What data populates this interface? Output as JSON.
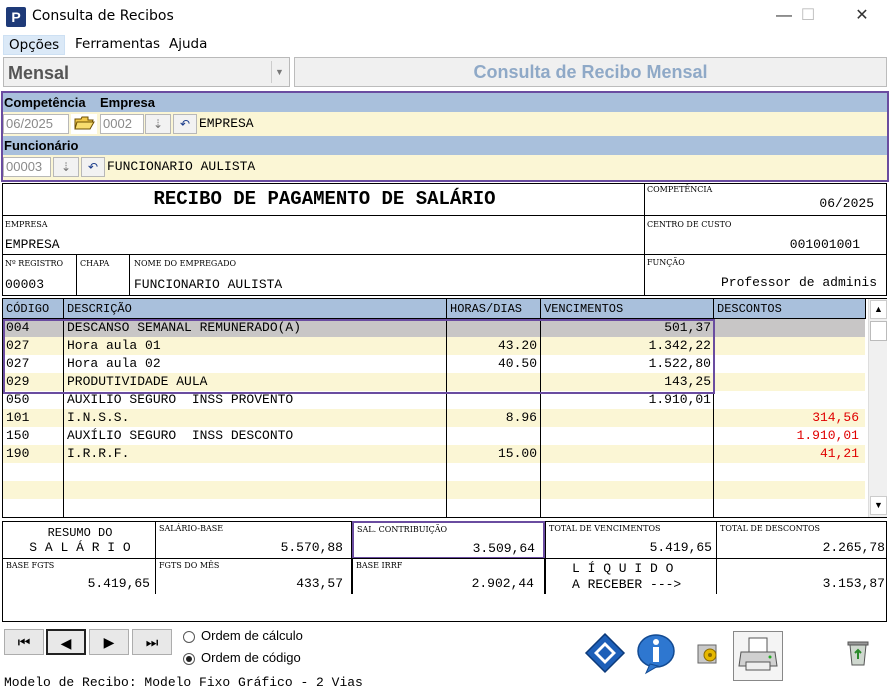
{
  "window": {
    "title": "Consulta de Recibos",
    "icon_letter": "P",
    "minimize": "—",
    "maximize": "☐",
    "close": "✕"
  },
  "menu": [
    "Opções",
    "Ferramentas",
    "Ajuda"
  ],
  "header": {
    "mode_value": "Mensal",
    "banner": "Consulta de Recibo Mensal"
  },
  "filters": {
    "competencia_label": "Competência",
    "empresa_label": "Empresa",
    "funcionario_label": "Funcionário",
    "competencia_value": "06/2025",
    "empresa_code": "0002",
    "empresa_name": "EMPRESA",
    "funcionario_code": "00003",
    "funcionario_name": "FUNCIONARIO  AULISTA"
  },
  "receipt": {
    "title": "RECIBO DE PAGAMENTO DE SALÁRIO",
    "competencia_label": "COMPETÊNCIA",
    "competencia": "06/2025",
    "empresa_label": "EMPRESA",
    "empresa": "EMPRESA",
    "centro_label": "CENTRO DE CUSTO",
    "centro": "001001001",
    "registro_label": "Nº REGISTRO",
    "registro": "00003",
    "chapa_label": "CHAPA",
    "chapa": "",
    "nome_label": "NOME DO EMPREGADO",
    "nome": "FUNCIONARIO  AULISTA",
    "funcao_label": "FUNÇÃO",
    "funcao": "Professor de adminis"
  },
  "table": {
    "headers": [
      "CÓDIGO",
      "DESCRIÇÃO",
      "HORAS/DIAS",
      "VENCIMENTOS",
      "DESCONTOS"
    ],
    "rows": [
      {
        "codigo": "004",
        "descricao": "DESCANSO SEMANAL REMUNERADO(A)",
        "horas": "",
        "vencimentos": "501,37",
        "descontos": ""
      },
      {
        "codigo": "027",
        "descricao": "Hora aula 01",
        "horas": "43.20",
        "vencimentos": "1.342,22",
        "descontos": ""
      },
      {
        "codigo": "027",
        "descricao": "Hora aula 02",
        "horas": "40.50",
        "vencimentos": "1.522,80",
        "descontos": ""
      },
      {
        "codigo": "029",
        "descricao": "PRODUTIVIDADE AULA",
        "horas": "",
        "vencimentos": "143,25",
        "descontos": ""
      },
      {
        "codigo": "050",
        "descricao": "AUXÍLIO SEGURO  INSS PROVENTO",
        "horas": "",
        "vencimentos": "1.910,01",
        "descontos": ""
      },
      {
        "codigo": "101",
        "descricao": "I.N.S.S.",
        "horas": "8.96",
        "vencimentos": "",
        "descontos": "314,56"
      },
      {
        "codigo": "150",
        "descricao": "AUXÍLIO SEGURO  INSS DESCONTO",
        "horas": "",
        "vencimentos": "",
        "descontos": "1.910,01"
      },
      {
        "codigo": "190",
        "descricao": "I.R.R.F.",
        "horas": "15.00",
        "vencimentos": "",
        "descontos": "41,21"
      }
    ],
    "discount_color": "#e00000"
  },
  "summary": {
    "resumo_line1": "RESUMO DO",
    "resumo_line2": "S A L Á R I O",
    "salario_base_label": "SALÁRIO-BASE",
    "salario_base": "5.570,88",
    "sal_contrib_label": "SAL. CONTRIBUIÇÃO",
    "sal_contrib": "3.509,64",
    "total_venc_label": "TOTAL DE VENCIMENTOS",
    "total_venc": "5.419,65",
    "total_desc_label": "TOTAL DE DESCONTOS",
    "total_desc": "2.265,78",
    "base_fgts_label": "BASE FGTS",
    "base_fgts": "5.419,65",
    "fgts_mes_label": "FGTS DO MÊS",
    "fgts_mes": "433,57",
    "base_irrf_label": "BASE IRRF",
    "base_irrf": "2.902,44",
    "liquido_line1": "L Í Q U I D O",
    "liquido_line2": "A RECEBER --->",
    "liquido": "3.153,87"
  },
  "bottom": {
    "order_calc": "Ordem de cálculo",
    "order_code": "Ordem de código",
    "model": "Modelo de Recibo: Modelo Fixo Gráfico - 2 Vias"
  },
  "colors": {
    "band": "#a9c0dc",
    "highlight_border": "#6a4ca0",
    "banner_text": "#8fa9c7",
    "row_yellow": "#fbf6d5",
    "row_selected": "#c8c6c6"
  },
  "icons": [
    "first-icon",
    "prev-icon",
    "next-icon",
    "last-icon",
    "calculator-icon",
    "info-icon",
    "settings-icon",
    "printer-icon",
    "recycle-bin-icon"
  ]
}
